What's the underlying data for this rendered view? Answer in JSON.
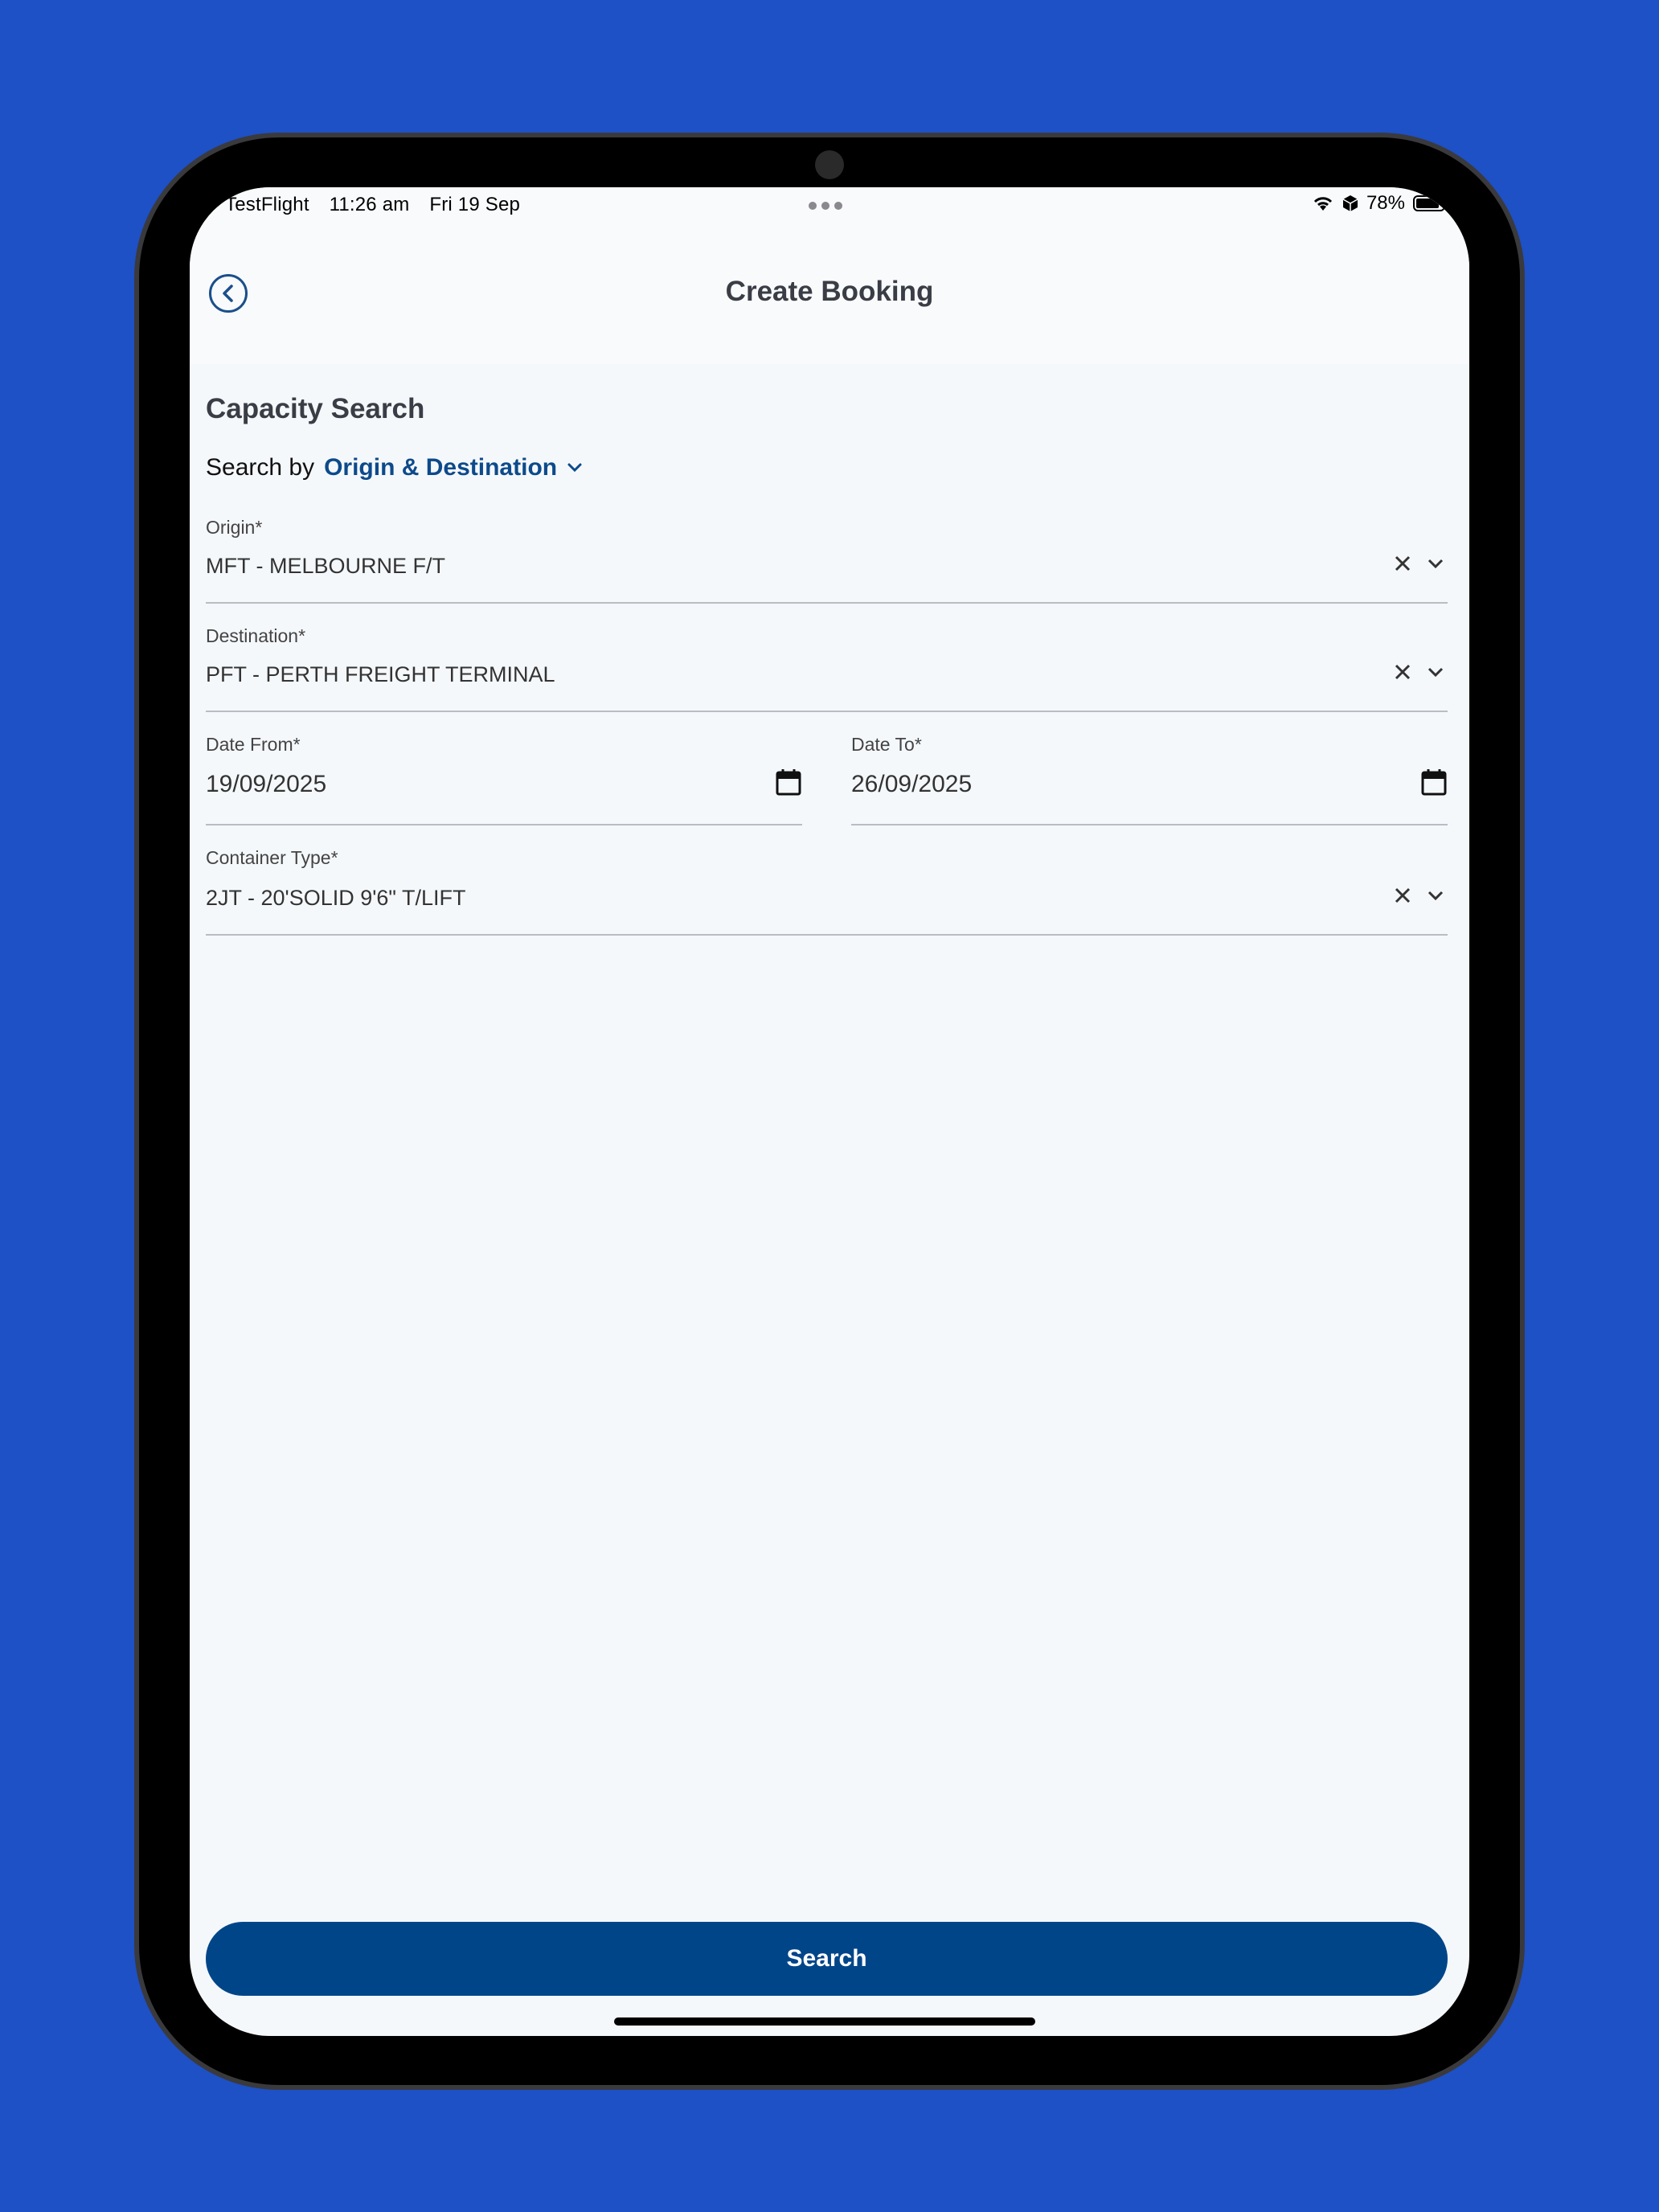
{
  "status_bar": {
    "app": "TestFlight",
    "time": "11:26 am",
    "date": "Fri 19 Sep",
    "battery": "78%",
    "battery_level": 0.78
  },
  "header": {
    "title": "Create Booking",
    "back_icon": "chevron-left-circle-icon"
  },
  "form": {
    "section_title": "Capacity Search",
    "search_by_label": "Search by",
    "search_by_value": "Origin & Destination",
    "origin": {
      "label": "Origin*",
      "value": "MFT - MELBOURNE F/T"
    },
    "destination": {
      "label": "Destination*",
      "value": "PFT - PERTH FREIGHT TERMINAL"
    },
    "date_from": {
      "label": "Date From*",
      "value": "19/09/2025"
    },
    "date_to": {
      "label": "Date To*",
      "value": "26/09/2025"
    },
    "container_type": {
      "label": "Container Type*",
      "value": "2JT - 20'SOLID 9'6\" T/LIFT"
    }
  },
  "actions": {
    "search_label": "Search"
  },
  "colors": {
    "background": "#1e50c6",
    "primary": "#014589",
    "accent_text": "#0d4a8b"
  }
}
